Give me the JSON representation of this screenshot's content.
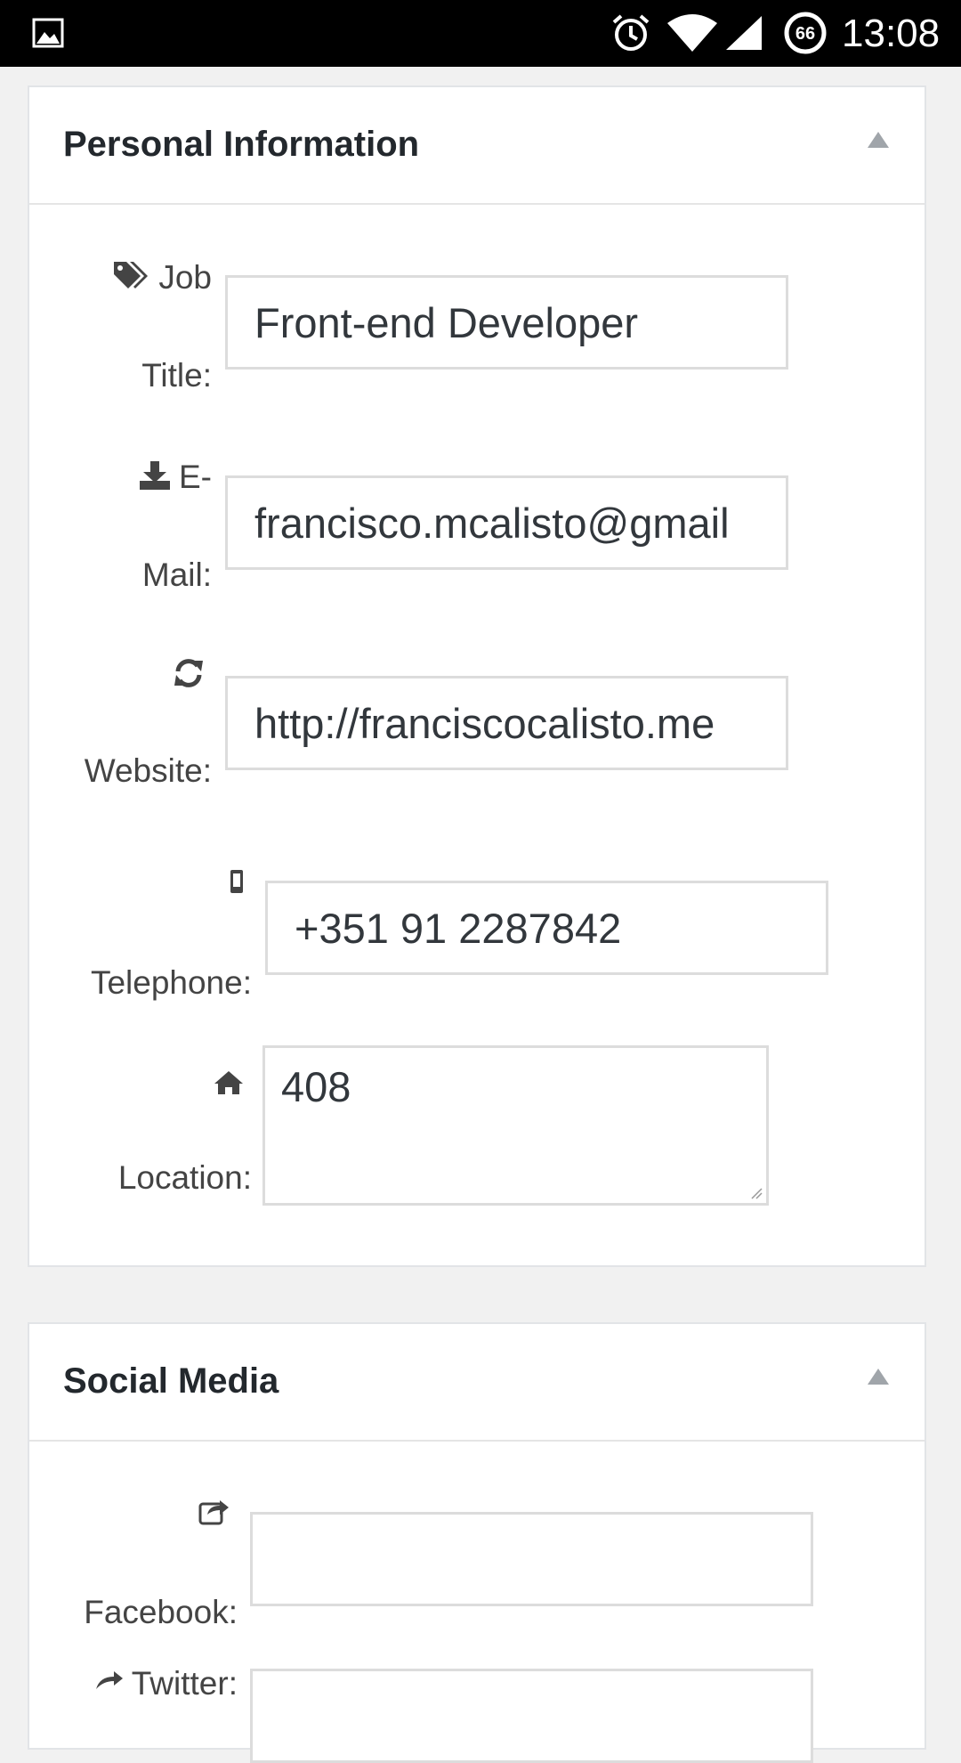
{
  "status_bar": {
    "time": "13:08",
    "battery_level": "66",
    "icons": [
      "gallery-icon",
      "alarm-icon",
      "wifi-icon",
      "signal-icon",
      "battery-icon"
    ]
  },
  "personal_info": {
    "title": "Personal Information",
    "fields": {
      "job_title": {
        "label_line1": "Job",
        "label_line2": "Title:",
        "value": "Front-end Developer",
        "icon": "tags-icon"
      },
      "email": {
        "label_line1": "E-",
        "label_line2": "Mail:",
        "value": "francisco.mcalisto@gmail",
        "icon": "download-icon"
      },
      "website": {
        "label_line1": "",
        "label_line2": "Website:",
        "value": "http://franciscocalisto.me",
        "icon": "refresh-icon"
      },
      "telephone": {
        "label_line1": "",
        "label_line2": "Telephone:",
        "value": "+351 91 2287842",
        "icon": "mobile-icon"
      },
      "location": {
        "label_line1": "",
        "label_line2": "Location:",
        "value": "408",
        "icon": "home-icon"
      }
    }
  },
  "social_media": {
    "title": "Social Media",
    "fields": {
      "facebook": {
        "label": "Facebook:",
        "value": "",
        "icon": "share-icon"
      },
      "twitter": {
        "label": "Twitter:",
        "value": "",
        "icon": "share-icon"
      }
    }
  },
  "colors": {
    "status_bar_bg": "#000000",
    "page_bg": "#f1f1f1",
    "panel_bg": "#ffffff",
    "border": "#dcdcdc",
    "text": "#23282d"
  }
}
